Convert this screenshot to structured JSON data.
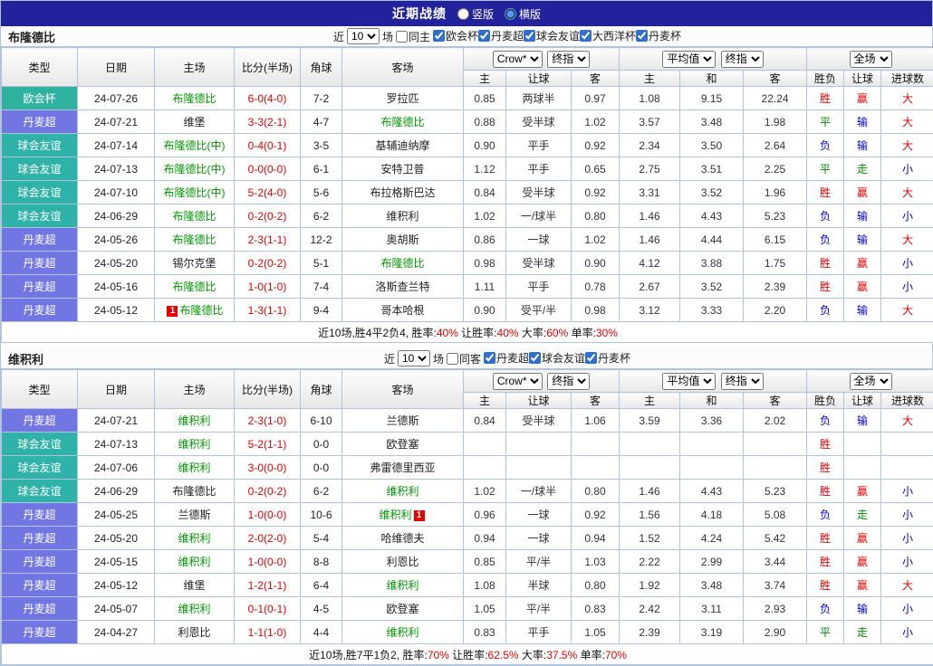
{
  "header": {
    "title": "近期战绩",
    "layout_options": [
      {
        "label": "竖版",
        "selected": false
      },
      {
        "label": "横版",
        "selected": true
      }
    ]
  },
  "columns": {
    "main": [
      "类型",
      "日期",
      "主场",
      "比分(半场)",
      "角球",
      "客场"
    ],
    "sub": [
      "主",
      "让球",
      "客",
      "主",
      "和",
      "客",
      "胜负",
      "让球",
      "进球数"
    ]
  },
  "league_colors": {
    "欧会杯": "#2fb3a0",
    "丹麦超": "#7276e3",
    "球会友谊": "#2fb3a8"
  },
  "result_colors": {
    "胜": "#e60000",
    "平": "#008800",
    "负": "#0000dd",
    "赢": "#e60000",
    "走": "#008800",
    "输": "#0000dd",
    "大": "#e60000",
    "小": "#0000dd"
  },
  "theme": {
    "topbar_bg": "#22229c",
    "border": "#b0c4de",
    "team_highlight": "#009900",
    "score_color": "#e60000"
  },
  "tables": [
    {
      "team": "布隆德比",
      "filter": {
        "near_label": "近",
        "count": "10",
        "games_label": "场",
        "same_label": "同主",
        "same_checked": false,
        "leagues": [
          "欧会杯",
          "丹麦超",
          "球会友谊",
          "大西洋杯",
          "丹麦杯"
        ]
      },
      "selects": {
        "odds_source": "Crow*",
        "odds_stage": "终指",
        "avg_source": "平均值",
        "avg_stage": "终指",
        "scope": "全场"
      },
      "rows": [
        {
          "league": "欧会杯",
          "date": "24-07-26",
          "home": "布隆德比",
          "home_team": true,
          "home_card": "",
          "score": "6-0(4-0)",
          "corner": "7-2",
          "away": "罗拉匹",
          "away_team": false,
          "away_card": "",
          "o1": "0.85",
          "o2": "两球半",
          "o3": "0.97",
          "a1": "1.08",
          "a2": "9.15",
          "a3": "22.24",
          "r1": "胜",
          "r2": "赢",
          "r3": "大"
        },
        {
          "league": "丹麦超",
          "date": "24-07-21",
          "home": "维堡",
          "home_team": false,
          "home_card": "",
          "score": "3-3(2-1)",
          "corner": "4-7",
          "away": "布隆德比",
          "away_team": true,
          "away_card": "",
          "o1": "0.88",
          "o2": "受半球",
          "o3": "1.02",
          "a1": "3.57",
          "a2": "3.48",
          "a3": "1.98",
          "r1": "平",
          "r2": "输",
          "r3": "大"
        },
        {
          "league": "球会友谊",
          "date": "24-07-14",
          "home": "布隆德比(中)",
          "home_team": true,
          "home_card": "",
          "score": "0-4(0-1)",
          "corner": "3-5",
          "away": "基辅迪纳摩",
          "away_team": false,
          "away_card": "",
          "o1": "0.90",
          "o2": "平手",
          "o3": "0.92",
          "a1": "2.34",
          "a2": "3.50",
          "a3": "2.64",
          "r1": "负",
          "r2": "输",
          "r3": "大"
        },
        {
          "league": "球会友谊",
          "date": "24-07-13",
          "home": "布隆德比(中)",
          "home_team": true,
          "home_card": "",
          "score": "0-0(0-0)",
          "corner": "6-1",
          "away": "安特卫普",
          "away_team": false,
          "away_card": "",
          "o1": "1.12",
          "o2": "平手",
          "o3": "0.65",
          "a1": "2.75",
          "a2": "3.51",
          "a3": "2.25",
          "r1": "平",
          "r2": "走",
          "r3": "小"
        },
        {
          "league": "球会友谊",
          "date": "24-07-10",
          "home": "布隆德比(中)",
          "home_team": true,
          "home_card": "",
          "score": "5-2(4-0)",
          "corner": "5-6",
          "away": "布拉格斯巴达",
          "away_team": false,
          "away_card": "",
          "o1": "0.84",
          "o2": "受半球",
          "o3": "0.92",
          "a1": "3.31",
          "a2": "3.52",
          "a3": "1.96",
          "r1": "胜",
          "r2": "赢",
          "r3": "大"
        },
        {
          "league": "球会友谊",
          "date": "24-06-29",
          "home": "布隆德比",
          "home_team": true,
          "home_card": "",
          "score": "0-2(0-2)",
          "corner": "6-2",
          "away": "维积利",
          "away_team": false,
          "away_card": "",
          "o1": "1.02",
          "o2": "一/球半",
          "o3": "0.80",
          "a1": "1.46",
          "a2": "4.43",
          "a3": "5.23",
          "r1": "负",
          "r2": "输",
          "r3": "小"
        },
        {
          "league": "丹麦超",
          "date": "24-05-26",
          "home": "布隆德比",
          "home_team": true,
          "home_card": "",
          "score": "2-3(1-1)",
          "corner": "12-2",
          "away": "奥胡斯",
          "away_team": false,
          "away_card": "",
          "o1": "0.86",
          "o2": "一球",
          "o3": "1.02",
          "a1": "1.46",
          "a2": "4.44",
          "a3": "6.15",
          "r1": "负",
          "r2": "输",
          "r3": "大"
        },
        {
          "league": "丹麦超",
          "date": "24-05-20",
          "home": "锡尔克堡",
          "home_team": false,
          "home_card": "",
          "score": "0-2(0-2)",
          "corner": "5-1",
          "away": "布隆德比",
          "away_team": true,
          "away_card": "",
          "o1": "0.98",
          "o2": "受半球",
          "o3": "0.90",
          "a1": "4.12",
          "a2": "3.88",
          "a3": "1.75",
          "r1": "胜",
          "r2": "赢",
          "r3": "小"
        },
        {
          "league": "丹麦超",
          "date": "24-05-16",
          "home": "布隆德比",
          "home_team": true,
          "home_card": "",
          "score": "1-0(1-0)",
          "corner": "7-4",
          "away": "洛斯查兰特",
          "away_team": false,
          "away_card": "",
          "o1": "1.11",
          "o2": "平手",
          "o3": "0.78",
          "a1": "2.67",
          "a2": "3.52",
          "a3": "2.39",
          "r1": "胜",
          "r2": "赢",
          "r3": "小"
        },
        {
          "league": "丹麦超",
          "date": "24-05-12",
          "home": "布隆德比",
          "home_team": true,
          "home_card": "1",
          "score": "1-3(1-1)",
          "corner": "9-4",
          "away": "哥本哈根",
          "away_team": false,
          "away_card": "",
          "o1": "0.90",
          "o2": "受平/半",
          "o3": "0.98",
          "a1": "3.12",
          "a2": "3.33",
          "a3": "2.20",
          "r1": "负",
          "r2": "输",
          "r3": "大"
        }
      ],
      "summary": {
        "prefix": "近10场,胜4平2负4,",
        "stats": [
          {
            "label": "胜率:",
            "value": "40%"
          },
          {
            "label": "让胜率:",
            "value": "40%"
          },
          {
            "label": "大率:",
            "value": "60%"
          },
          {
            "label": "单率:",
            "value": "30%"
          }
        ]
      }
    },
    {
      "team": "维积利",
      "filter": {
        "near_label": "近",
        "count": "10",
        "games_label": "场",
        "same_label": "同客",
        "same_checked": false,
        "leagues": [
          "丹麦超",
          "球会友谊",
          "丹麦杯"
        ]
      },
      "selects": {
        "odds_source": "Crow*",
        "odds_stage": "终指",
        "avg_source": "平均值",
        "avg_stage": "终指",
        "scope": "全场"
      },
      "rows": [
        {
          "league": "丹麦超",
          "date": "24-07-21",
          "home": "维积利",
          "home_team": true,
          "home_card": "",
          "score": "2-3(1-0)",
          "corner": "6-10",
          "away": "兰德斯",
          "away_team": false,
          "away_card": "",
          "o1": "0.84",
          "o2": "受半球",
          "o3": "1.06",
          "a1": "3.59",
          "a2": "3.36",
          "a3": "2.02",
          "r1": "负",
          "r2": "输",
          "r3": "大"
        },
        {
          "league": "球会友谊",
          "date": "24-07-13",
          "home": "维积利",
          "home_team": true,
          "home_card": "",
          "score": "5-2(1-1)",
          "corner": "0-0",
          "away": "欧登塞",
          "away_team": false,
          "away_card": "",
          "o1": "",
          "o2": "",
          "o3": "",
          "a1": "",
          "a2": "",
          "a3": "",
          "r1": "胜",
          "r2": "",
          "r3": ""
        },
        {
          "league": "球会友谊",
          "date": "24-07-06",
          "home": "维积利",
          "home_team": true,
          "home_card": "",
          "score": "3-0(0-0)",
          "corner": "0-0",
          "away": "弗雷德里西亚",
          "away_team": false,
          "away_card": "",
          "o1": "",
          "o2": "",
          "o3": "",
          "a1": "",
          "a2": "",
          "a3": "",
          "r1": "胜",
          "r2": "",
          "r3": ""
        },
        {
          "league": "球会友谊",
          "date": "24-06-29",
          "home": "布隆德比",
          "home_team": false,
          "home_card": "",
          "score": "0-2(0-2)",
          "corner": "6-2",
          "away": "维积利",
          "away_team": true,
          "away_card": "",
          "o1": "1.02",
          "o2": "一/球半",
          "o3": "0.80",
          "a1": "1.46",
          "a2": "4.43",
          "a3": "5.23",
          "r1": "胜",
          "r2": "赢",
          "r3": "小"
        },
        {
          "league": "丹麦超",
          "date": "24-05-25",
          "home": "兰德斯",
          "home_team": false,
          "home_card": "",
          "score": "1-0(0-0)",
          "corner": "10-6",
          "away": "维积利",
          "away_team": true,
          "away_card": "1",
          "o1": "0.96",
          "o2": "一球",
          "o3": "0.92",
          "a1": "1.56",
          "a2": "4.18",
          "a3": "5.08",
          "r1": "负",
          "r2": "走",
          "r3": "小"
        },
        {
          "league": "丹麦超",
          "date": "24-05-20",
          "home": "维积利",
          "home_team": true,
          "home_card": "",
          "score": "2-0(2-0)",
          "corner": "5-4",
          "away": "哈维德夫",
          "away_team": false,
          "away_card": "",
          "o1": "0.94",
          "o2": "一球",
          "o3": "0.94",
          "a1": "1.52",
          "a2": "4.24",
          "a3": "5.42",
          "r1": "胜",
          "r2": "赢",
          "r3": "小"
        },
        {
          "league": "丹麦超",
          "date": "24-05-15",
          "home": "维积利",
          "home_team": true,
          "home_card": "",
          "score": "1-0(0-0)",
          "corner": "8-8",
          "away": "利恩比",
          "away_team": false,
          "away_card": "",
          "o1": "0.85",
          "o2": "平/半",
          "o3": "1.03",
          "a1": "2.22",
          "a2": "2.99",
          "a3": "3.44",
          "r1": "胜",
          "r2": "赢",
          "r3": "小"
        },
        {
          "league": "丹麦超",
          "date": "24-05-12",
          "home": "维堡",
          "home_team": false,
          "home_card": "",
          "score": "1-2(1-1)",
          "corner": "6-4",
          "away": "维积利",
          "away_team": true,
          "away_card": "",
          "o1": "1.08",
          "o2": "半球",
          "o3": "0.80",
          "a1": "1.92",
          "a2": "3.48",
          "a3": "3.74",
          "r1": "胜",
          "r2": "赢",
          "r3": "大"
        },
        {
          "league": "丹麦超",
          "date": "24-05-07",
          "home": "维积利",
          "home_team": true,
          "home_card": "",
          "score": "0-1(0-1)",
          "corner": "4-5",
          "away": "欧登塞",
          "away_team": false,
          "away_card": "",
          "o1": "1.05",
          "o2": "平/半",
          "o3": "0.83",
          "a1": "2.42",
          "a2": "3.11",
          "a3": "2.93",
          "r1": "负",
          "r2": "输",
          "r3": "小"
        },
        {
          "league": "丹麦超",
          "date": "24-04-27",
          "home": "利恩比",
          "home_team": false,
          "home_card": "",
          "score": "1-1(1-0)",
          "corner": "4-4",
          "away": "维积利",
          "away_team": true,
          "away_card": "",
          "o1": "0.83",
          "o2": "平手",
          "o3": "1.05",
          "a1": "2.39",
          "a2": "3.19",
          "a3": "2.90",
          "r1": "平",
          "r2": "走",
          "r3": "小"
        }
      ],
      "summary": {
        "prefix": "近10场,胜7平1负2,",
        "stats": [
          {
            "label": "胜率:",
            "value": "70%"
          },
          {
            "label": "让胜率:",
            "value": "62.5%"
          },
          {
            "label": "大率:",
            "value": "37.5%"
          },
          {
            "label": "单率:",
            "value": "70%"
          }
        ]
      }
    }
  ]
}
